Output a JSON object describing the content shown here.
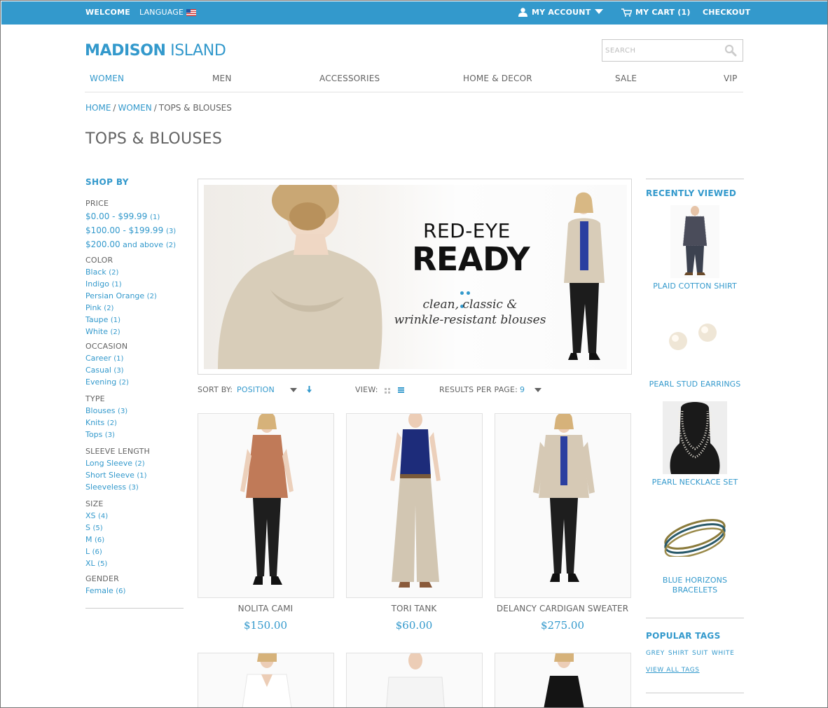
{
  "topbar": {
    "welcome": "WELCOME",
    "language": "LANGUAGE",
    "my_account": "MY ACCOUNT",
    "my_cart": "MY CART (1)",
    "checkout": "CHECKOUT"
  },
  "logo": {
    "bold": "MADISON",
    "regular": " ISLAND"
  },
  "search": {
    "placeholder": "SEARCH"
  },
  "nav": [
    "WOMEN",
    "MEN",
    "ACCESSORIES",
    "HOME & DECOR",
    "SALE",
    "VIP"
  ],
  "breadcrumb": {
    "home": "HOME",
    "women": "WOMEN",
    "current": "TOPS & BLOUSES",
    "separator": "/"
  },
  "page_title": "TOPS & BLOUSES",
  "shop_by": "SHOP BY",
  "filters": {
    "price": {
      "title": "PRICE",
      "items": [
        {
          "label": "$0.00 - $99.99",
          "count": "(1)"
        },
        {
          "label": "$100.00 - $199.99",
          "count": "(3)"
        },
        {
          "label": "$200.00",
          "suffix": " and above",
          "count": "(2)"
        }
      ]
    },
    "color": {
      "title": "COLOR",
      "items": [
        {
          "label": "Black",
          "count": "(2)"
        },
        {
          "label": "Indigo",
          "count": "(1)"
        },
        {
          "label": "Persian Orange",
          "count": "(2)"
        },
        {
          "label": "Pink",
          "count": "(2)"
        },
        {
          "label": "Taupe",
          "count": "(1)"
        },
        {
          "label": "White",
          "count": "(2)"
        }
      ]
    },
    "occasion": {
      "title": "OCCASION",
      "items": [
        {
          "label": "Career",
          "count": "(1)"
        },
        {
          "label": "Casual",
          "count": "(3)"
        },
        {
          "label": "Evening",
          "count": "(2)"
        }
      ]
    },
    "type": {
      "title": "TYPE",
      "items": [
        {
          "label": "Blouses",
          "count": "(3)"
        },
        {
          "label": "Knits",
          "count": "(2)"
        },
        {
          "label": "Tops",
          "count": "(3)"
        }
      ]
    },
    "sleeve": {
      "title": "SLEEVE LENGTH",
      "items": [
        {
          "label": "Long Sleeve",
          "count": "(2)"
        },
        {
          "label": "Short Sleeve",
          "count": "(1)"
        },
        {
          "label": "Sleeveless",
          "count": "(3)"
        }
      ]
    },
    "size": {
      "title": "SIZE",
      "items": [
        {
          "label": "XS",
          "count": "(4)"
        },
        {
          "label": "S",
          "count": "(5)"
        },
        {
          "label": "M",
          "count": "(6)"
        },
        {
          "label": "L",
          "count": "(6)"
        },
        {
          "label": "XL",
          "count": "(5)"
        }
      ]
    },
    "gender": {
      "title": "GENDER",
      "items": [
        {
          "label": "Female",
          "count": "(6)"
        }
      ]
    }
  },
  "banner": {
    "line1": "RED-EYE",
    "line2": "READY",
    "sub1": "clean, classic &",
    "sub2": "wrinkle-resistant blouses"
  },
  "toolbar": {
    "sort_by": "SORT BY:",
    "sort_value": "POSITION",
    "view": "VIEW:",
    "results_per_page": "RESULTS PER PAGE:",
    "results_value": "9"
  },
  "products": [
    {
      "name": "NOLITA CAMI",
      "price": "$150.00",
      "top_color": "#c07a58",
      "bottom_color": "#1e1e1e"
    },
    {
      "name": "TORI TANK",
      "price": "$60.00",
      "top_color": "#1d2c7a",
      "bottom_color": "#d2c6b2"
    },
    {
      "name": "DELANCY CARDIGAN SWEATER",
      "price": "$275.00",
      "top_color": "#d6c9b5",
      "bottom_color": "#1e1e1e"
    }
  ],
  "recently_viewed": {
    "title": "RECENTLY VIEWED",
    "items": [
      {
        "name": "PLAID COTTON SHIRT"
      },
      {
        "name": "PEARL STUD EARRINGS"
      },
      {
        "name": "PEARL NECKLACE SET"
      },
      {
        "name_line1": "BLUE HORIZONS",
        "name_line2": "BRACELETS"
      }
    ]
  },
  "popular_tags": {
    "title": "POPULAR TAGS",
    "tags": [
      "GREY",
      "SHIRT",
      "SUIT",
      "WHITE"
    ],
    "view_all": "VIEW ALL TAGS"
  },
  "colors": {
    "accent": "#3399cc",
    "text": "#636363",
    "border": "#e1e1e1"
  }
}
